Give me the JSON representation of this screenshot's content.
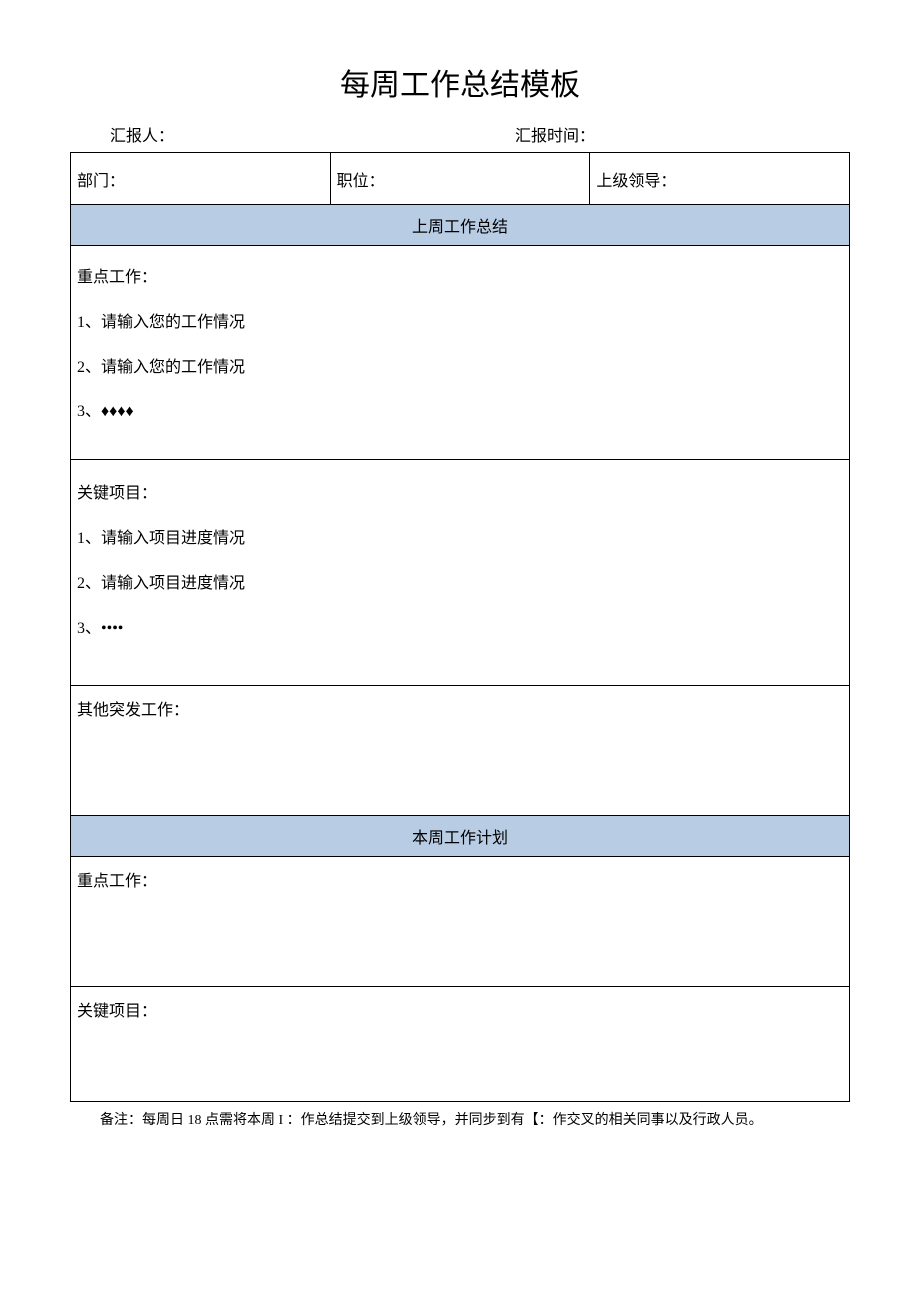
{
  "title": "每周工作总结模板",
  "header": {
    "reporter_label": "汇报人：",
    "report_time_label": "汇报时间："
  },
  "info_row": {
    "department_label": "部门：",
    "position_label": "职位：",
    "supervisor_label": "上级领导："
  },
  "last_week": {
    "section_title": "上周工作总结",
    "key_work": {
      "label": "重点工作：",
      "item1": "1、请输入您的工作情况",
      "item2": "2、请输入您的工作情况",
      "item3": "3、♦♦♦♦"
    },
    "key_project": {
      "label": "关键项目：",
      "item1": "1、请输入项目进度情况",
      "item2": "2、请输入项目进度情况",
      "item3": "3、••••"
    },
    "other_work": {
      "label": "其他突发工作："
    }
  },
  "this_week": {
    "section_title": "本周工作计划",
    "key_work": {
      "label": "重点工作："
    },
    "key_project": {
      "label": "关键项目："
    }
  },
  "footnote": "备注：每周日 18 点需将本周 I ：作总结提交到上级领导，并同步到有【：作交叉的相关同事以及行政人员。"
}
